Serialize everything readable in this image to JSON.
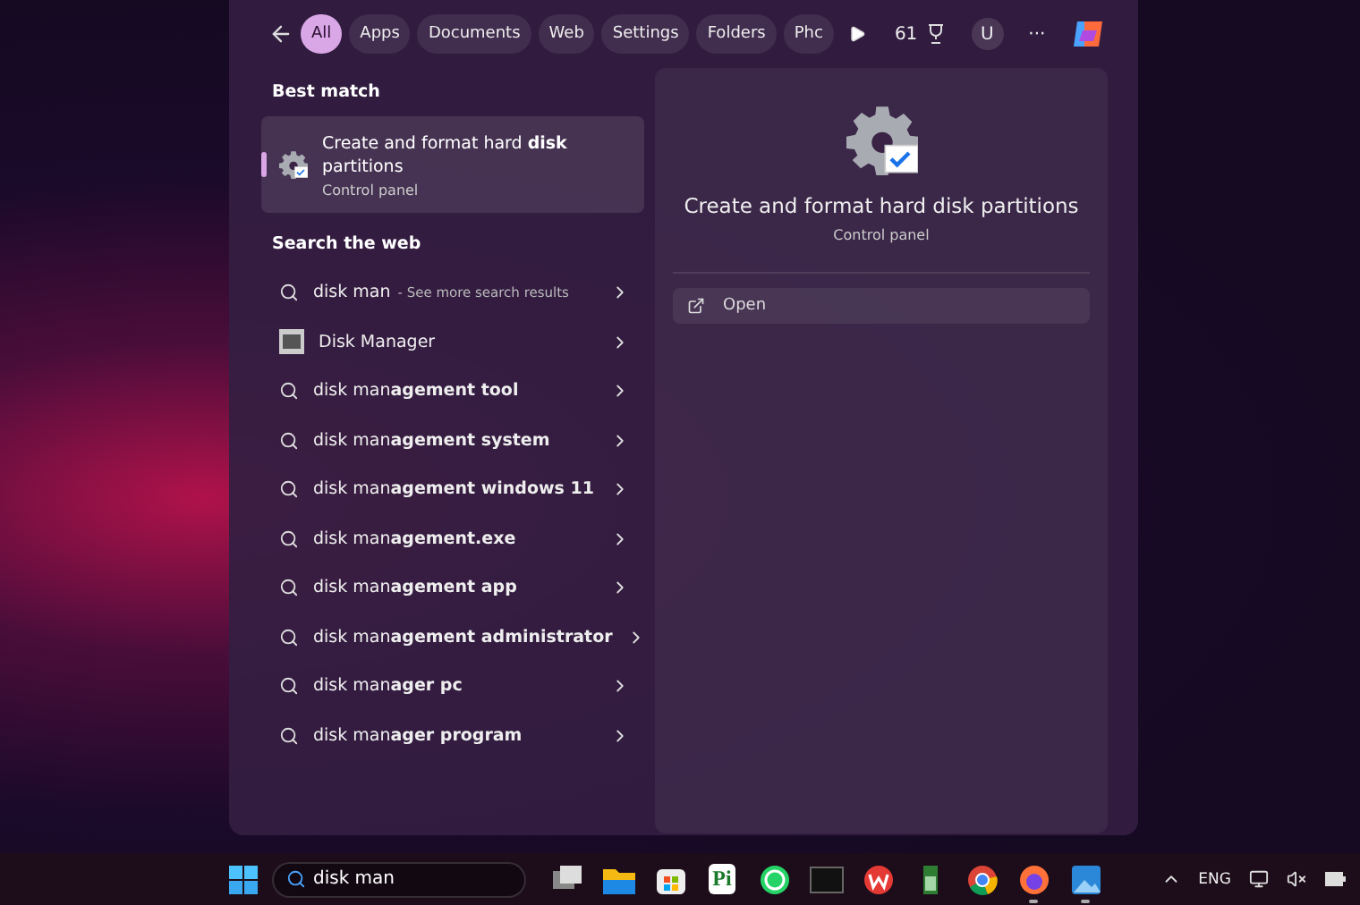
{
  "filters": [
    {
      "label": "All",
      "selected": true
    },
    {
      "label": "Apps",
      "selected": false
    },
    {
      "label": "Documents",
      "selected": false
    },
    {
      "label": "Web",
      "selected": false
    },
    {
      "label": "Settings",
      "selected": false
    },
    {
      "label": "Folders",
      "selected": false
    },
    {
      "label": "Phc",
      "selected": false
    }
  ],
  "points": "61",
  "avatar": "U",
  "more": "···",
  "best_match": {
    "heading": "Best match",
    "title": "Create and format hard **disk** partitions",
    "subtitle": "Control panel",
    "selected": true
  },
  "web": {
    "heading": "Search the web",
    "results": [
      {
        "kind": "search",
        "text": "disk man",
        "hint": "- See more search results"
      },
      {
        "kind": "app",
        "text": "Disk Manager"
      },
      {
        "kind": "search",
        "text": "disk man**agement tool**"
      },
      {
        "kind": "search",
        "text": "disk man**agement system**"
      },
      {
        "kind": "search",
        "text": "disk man**agement windows 11**"
      },
      {
        "kind": "search",
        "text": "disk man**agement.exe**"
      },
      {
        "kind": "search",
        "text": "disk man**agement app**"
      },
      {
        "kind": "search",
        "text": "disk man**agement administrator**"
      },
      {
        "kind": "search",
        "text": "disk man**ager pc**"
      },
      {
        "kind": "search",
        "text": "disk man**ager program**"
      }
    ]
  },
  "preview": {
    "title": "Create and format hard disk partitions",
    "subtitle": "Control panel",
    "actions": [
      {
        "label": "Open"
      }
    ]
  },
  "taskbar": {
    "search_value": "disk man",
    "apps": [
      {
        "kind": "taskview",
        "running": false
      },
      {
        "kind": "folder",
        "running": false
      },
      {
        "kind": "store",
        "running": false
      },
      {
        "kind": "letters",
        "label": "Pi",
        "running": false
      },
      {
        "kind": "chat",
        "running": false
      },
      {
        "kind": "terminal",
        "running": false
      },
      {
        "kind": "office",
        "running": false
      },
      {
        "kind": "battery",
        "running": false
      },
      {
        "kind": "chrome",
        "running": false
      },
      {
        "kind": "firefox",
        "running": true
      },
      {
        "kind": "photos",
        "running": true
      }
    ],
    "language": "ENG"
  }
}
